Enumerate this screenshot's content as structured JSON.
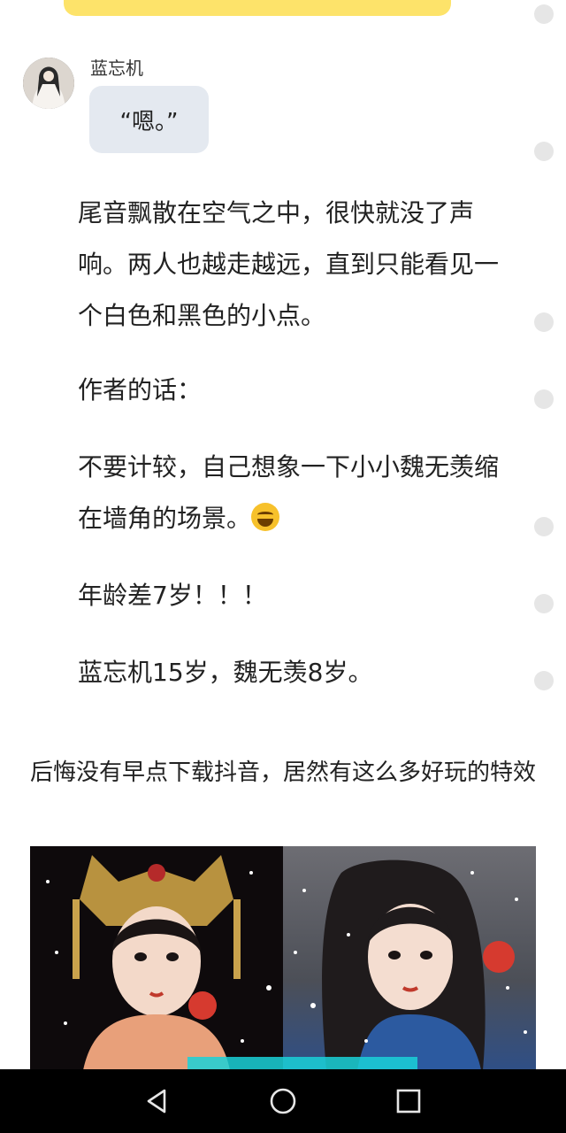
{
  "chat": {
    "speaker": "蓝忘机",
    "message": "“嗯。”"
  },
  "story": {
    "paragraph_1": "尾音飘散在空气之中，很快就没了声响。两人也越走越远，直到只能看见一个白色和黑色的小点。",
    "paragraph_2": "作者的话：",
    "paragraph_3": "不要计较，自己想象一下小小魏无羡缩在墙角的场景。",
    "paragraph_3_emoji": "laughing-crying-emoji",
    "paragraph_4": "年龄差7岁！！！",
    "paragraph_5": "蓝忘机15岁，魏无羡8岁。"
  },
  "ad": {
    "title": "后悔没有早点下载抖音，居然有这么多好玩的特效"
  },
  "nav": {
    "back_icon": "back-triangle-icon",
    "home_icon": "home-circle-icon",
    "recents_icon": "recents-square-icon"
  },
  "colors": {
    "top_bar": "#fde36a",
    "bubble": "#e4e9f0",
    "nav_bar": "#000000",
    "side_dots": "#e6e6e6"
  }
}
